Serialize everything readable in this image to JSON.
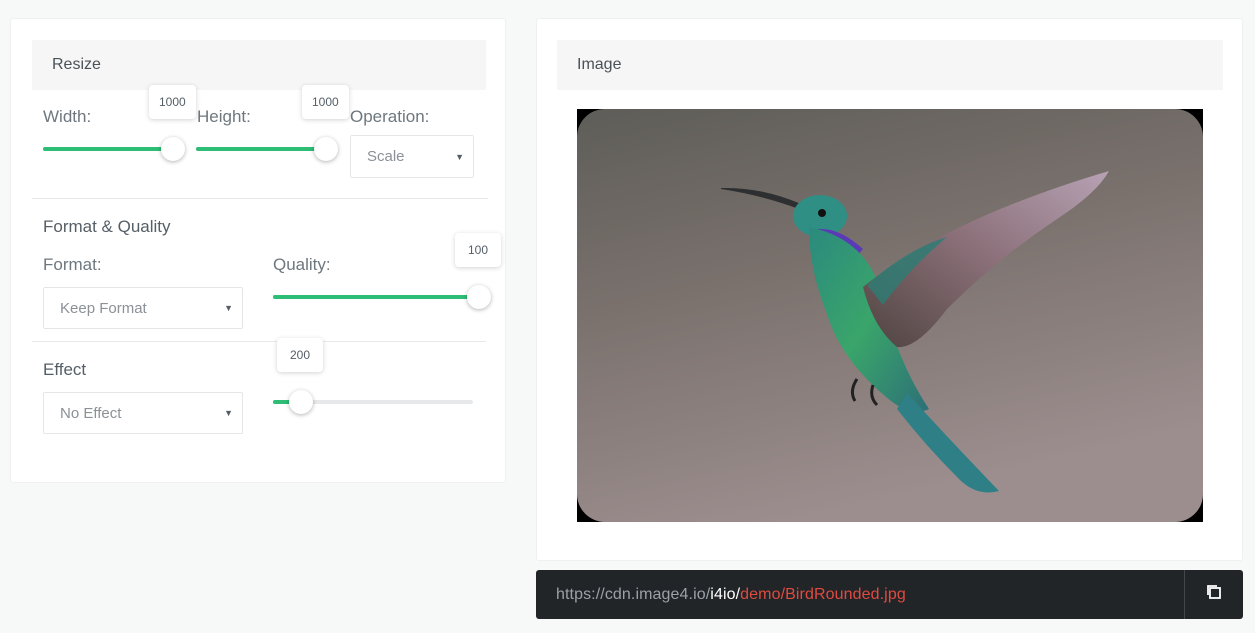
{
  "resize": {
    "header": "Resize",
    "width_label": "Width:",
    "height_label": "Height:",
    "operation_label": "Operation:",
    "width_value": "1000",
    "height_value": "1000",
    "operation_value": "Scale"
  },
  "format": {
    "title": "Format & Quality",
    "format_label": "Format:",
    "quality_label": "Quality:",
    "format_value": "Keep Format",
    "quality_value": "100"
  },
  "effect": {
    "title": "Effect",
    "effect_value": "No Effect",
    "amount_value": "200"
  },
  "sliders": {
    "width_fraction": 1.0,
    "height_fraction": 1.0,
    "quality_fraction": 1.0,
    "effect_fraction": 0.14
  },
  "image_panel": {
    "header": "Image"
  },
  "url": {
    "base": "https://cdn.image4.io/",
    "token": "i4io",
    "sep": "/",
    "path": "demo/BirdRounded.jpg"
  },
  "colors": {
    "accent_green": "#2dbd74",
    "url_path_red": "#e04a3f",
    "url_bar_bg": "#222528"
  },
  "icons": {
    "copy": "copy-icon",
    "caret": "caret-down-icon"
  }
}
